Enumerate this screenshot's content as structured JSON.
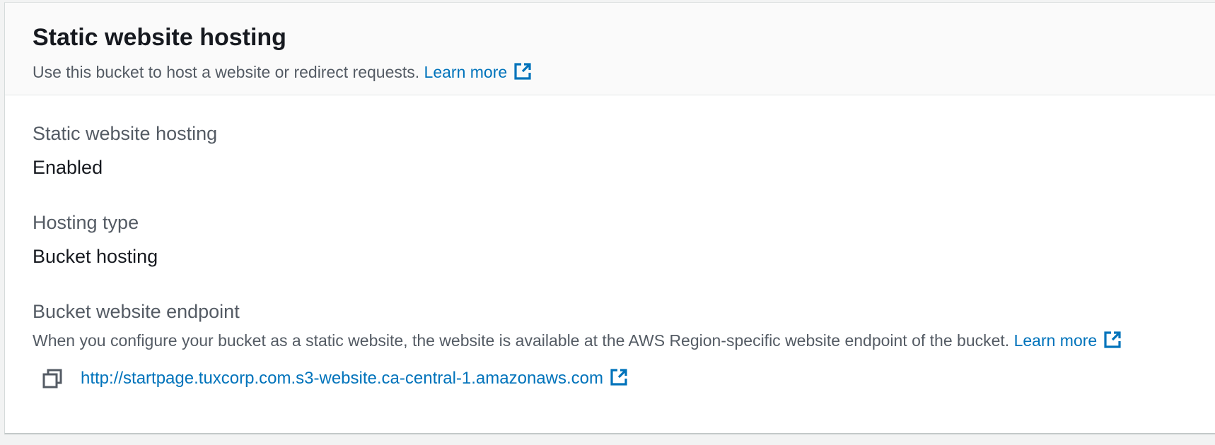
{
  "header": {
    "title": "Static website hosting",
    "description": "Use this bucket to host a website or redirect requests.",
    "learn_more": "Learn more"
  },
  "fields": {
    "hosting": {
      "label": "Static website hosting",
      "value": "Enabled"
    },
    "hosting_type": {
      "label": "Hosting type",
      "value": "Bucket hosting"
    },
    "endpoint": {
      "label": "Bucket website endpoint",
      "description": "When you configure your bucket as a static website, the website is available at the AWS Region-specific website endpoint of the bucket.",
      "learn_more": "Learn more",
      "url": "http://startpage.tuxcorp.com.s3-website.ca-central-1.amazonaws.com"
    }
  },
  "icons": {
    "external_link": "external-link-icon",
    "copy": "copy-icon"
  },
  "colors": {
    "link": "#0073bb",
    "title": "#16191f",
    "secondary_text": "#545b64",
    "header_bg": "#fafafa",
    "page_bg": "#f2f3f3"
  }
}
